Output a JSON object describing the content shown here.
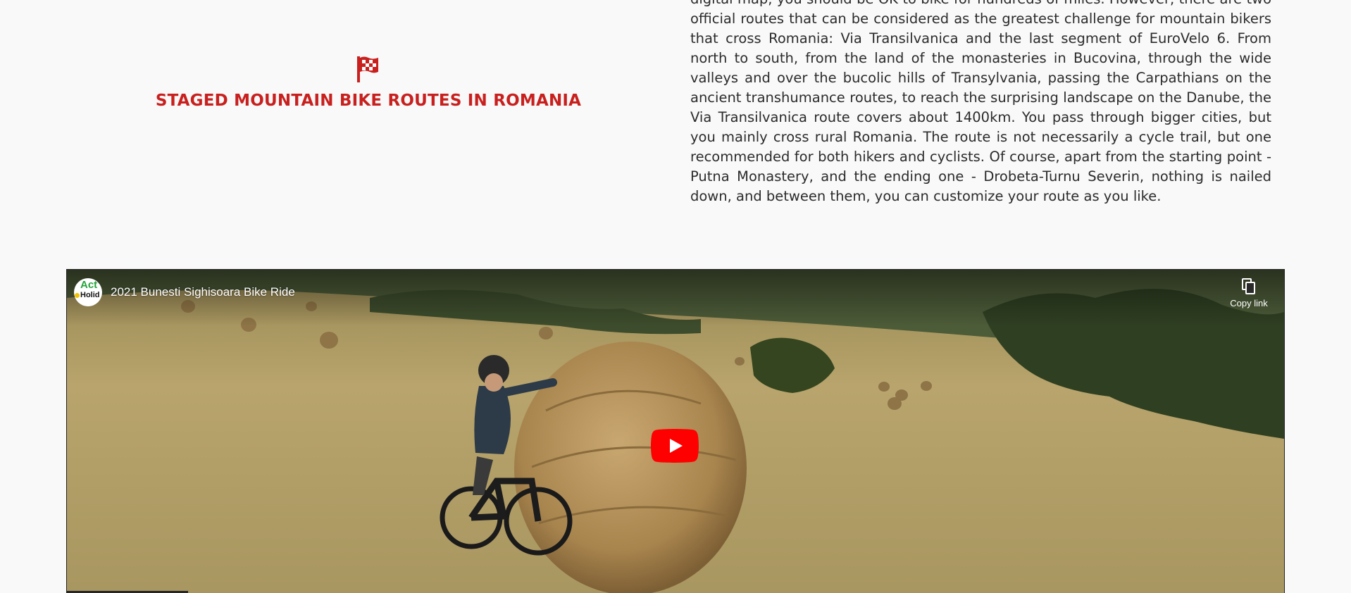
{
  "section": {
    "title": "STAGED MOUNTAIN BIKE ROUTES IN ROMANIA",
    "icon": "checkered-flag-icon",
    "accent_color": "#c8201e"
  },
  "article": {
    "text": "digital map, you should be OK to bike for hundreds of miles. However, there are two official routes that can be considered as the greatest challenge for mountain bikers that cross Romania: Via Transilvanica and the last segment of EuroVelo 6. From north to south, from the land of the monasteries in Bucovina, through the wide valleys and over the bucolic hills of Transylvania, passing the Carpathians on the ancient transhumance routes, to reach the surprising landscape on the Danube, the Via Transilvanica route covers about 1400km. You pass through bigger cities, but you mainly cross rural Romania. The route is not necessarily a cycle trail, but one recommended for both hikers and cyclists. Of course, apart from the starting point - Putna Monastery, and the ending one - Drobeta-Turnu Severin, nothing is nailed down, and between them, you can customize your route as you like."
  },
  "video": {
    "title": "2021 Bunesti Sighisoara Bike Ride",
    "copy_link_label": "Copy link",
    "channel_logo_text_1": "Act",
    "channel_logo_text_2": "Holid",
    "play_icon": "youtube-play-icon",
    "copy_icon": "copy-icon",
    "play_color": "#ff0000"
  }
}
